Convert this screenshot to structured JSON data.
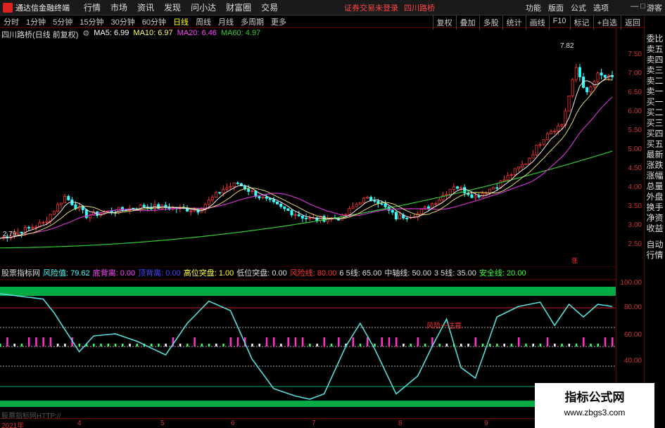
{
  "titlebar": {
    "app_title": "通达信金融终端",
    "menu": [
      "行情",
      "市场",
      "资讯",
      "发现",
      "问小达",
      "财富圈",
      "交易"
    ],
    "notice": "证券交易未登录",
    "stock_link": "四川路桥",
    "right_menu": [
      "功能",
      "版面",
      "公式",
      "选项"
    ],
    "guest": "游客"
  },
  "toolbar": {
    "periods": [
      "分时",
      "1分钟",
      "5分钟",
      "15分钟",
      "30分钟",
      "60分钟",
      "日线",
      "周线",
      "月线",
      "多周期",
      "更多"
    ],
    "active": "日线",
    "right_tools": [
      "复权",
      "叠加",
      "多股",
      "统计",
      "画线",
      "F10",
      "标记",
      "+自选",
      "返回"
    ]
  },
  "right_panel": {
    "items_top": [
      "委比",
      "卖五",
      "卖四",
      "卖三",
      "卖二",
      "卖一",
      "买一",
      "买二",
      "买三",
      "买四",
      "买五",
      "最新",
      "涨跌",
      "涨幅",
      "总量",
      "外盘",
      "换手",
      "净资",
      "收益"
    ],
    "items_bottom": [
      "自动",
      "行情"
    ]
  },
  "chart_info": {
    "title": "四川路桥(日线 前复权)",
    "ma5": "MA5: 6.99",
    "ma10": "MA10: 6.97",
    "ma20": "MA20: 6.46",
    "ma60": "MA60: 4.97",
    "colors": {
      "ma5": "#ffffff",
      "ma10": "#ffff66",
      "ma20": "#ff44ff",
      "ma60": "#33cc33"
    }
  },
  "price_axis": {
    "labels": [
      "7.50",
      "7.00",
      "6.50",
      "6.00",
      "5.50",
      "5.00",
      "4.50",
      "4.00",
      "3.50",
      "3.00",
      "2.50"
    ],
    "high_marker": "7.82",
    "low_marker": "2.79"
  },
  "indicator_info": {
    "name": "股票指标网",
    "fxz": "风险值: 79.62",
    "dbd": "底背离: 0.00",
    "dbl": "顶背离: 0.00",
    "gwtp": "高位突盘: 1.00",
    "dwtp": "低位突盘: 0.00",
    "fxx": "风险线: 80.00",
    "l65": "6 5线: 65.00",
    "zzx": "中轴线: 50.00",
    "l35": "3 5线: 35.00",
    "aqx": "安全线: 20.00",
    "annotation": "风险一注意"
  },
  "indicator_axis": {
    "labels": [
      "100.00",
      "80.00",
      "60.00",
      "40.00"
    ]
  },
  "date_axis": {
    "labels": [
      "2021年",
      "4",
      "5",
      "6",
      "7",
      "8",
      "9"
    ]
  },
  "watermark": {
    "title": "指标公式网",
    "url": "www.zbgs3.com"
  },
  "bottom_tag": "股票指标网HTTP://",
  "chart_data": {
    "type": "line",
    "price_series_note": "daily candlestick chart 2021 Jan–Sep",
    "ma_values": {
      "MA5": 6.99,
      "MA10": 6.97,
      "MA20": 6.46,
      "MA60": 4.97
    },
    "ylim": [
      2.5,
      7.82
    ]
  }
}
